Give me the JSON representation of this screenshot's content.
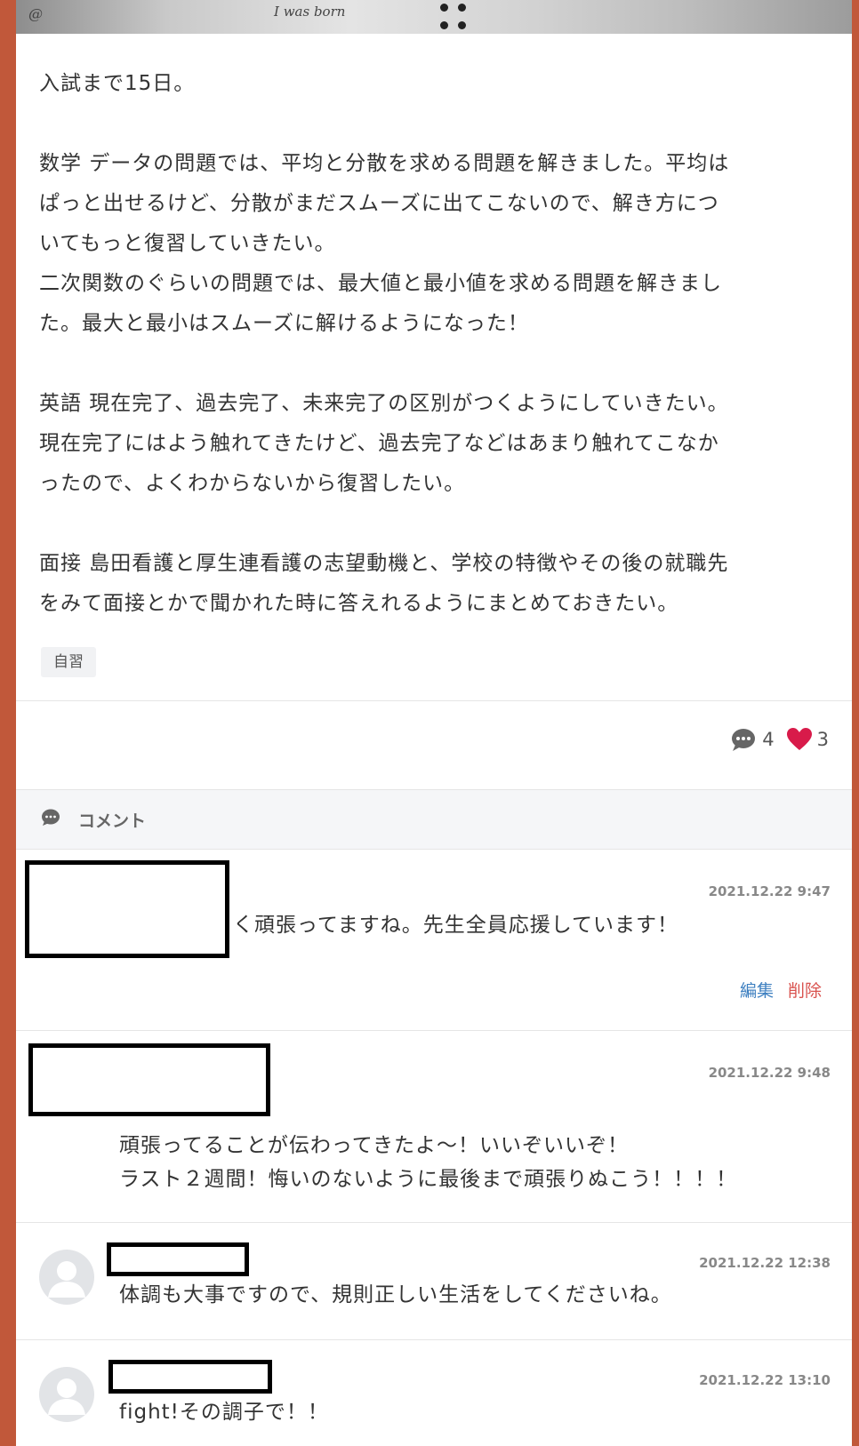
{
  "photo": {
    "scribble_left": "@",
    "scribble_mid": "I was born"
  },
  "post": {
    "paragraphs": [
      "入試まで15日。",
      "",
      "数学 データの問題では、平均と分散を求める問題を解きました。平均は",
      "ぱっと出せるけど、分散がまだスムーズに出てこないので、解き方につ",
      "いてもっと復習していきたい。",
      "二次関数のぐらいの問題では、最大値と最小値を求める問題を解きまし",
      "た。最大と最小はスムーズに解けるようになった！",
      "",
      "英語 現在完了、過去完了、未来完了の区別がつくようにしていきたい。",
      "現在完了にはよう触れてきたけど、過去完了などはあまり触れてこなか",
      "ったので、よくわからないから復習したい。",
      "",
      "面接 島田看護と厚生連看護の志望動機と、学校の特徴やその後の就職先",
      "をみて面接とかで聞かれた時に答えれるようにまとめておきたい。"
    ],
    "tag": "自習",
    "comment_count": "4",
    "like_count": "3"
  },
  "comments_section": {
    "header_label": "コメント",
    "comments": [
      {
        "timestamp": "2021.12.22 9:47",
        "text": "く頑張ってますね。先生全員応援しています！",
        "edit_label": "編集",
        "delete_label": "削除"
      },
      {
        "timestamp": "2021.12.22 9:48",
        "text": "頑張ってることが伝わってきたよ～！いいぞいいぞ！\nラスト２週間！悔いのないように最後まで頑張りぬこう！！！！"
      },
      {
        "timestamp": "2021.12.22 12:38",
        "text": "体調も大事ですので、規則正しい生活をしてくださいね。"
      },
      {
        "timestamp": "2021.12.22 13:10",
        "text": "fight!その調子で！！"
      }
    ]
  },
  "colors": {
    "frame": "#c1583a",
    "heart": "#d81b4a",
    "edit_link": "#3d7fc0",
    "delete_link": "#d9534f"
  }
}
